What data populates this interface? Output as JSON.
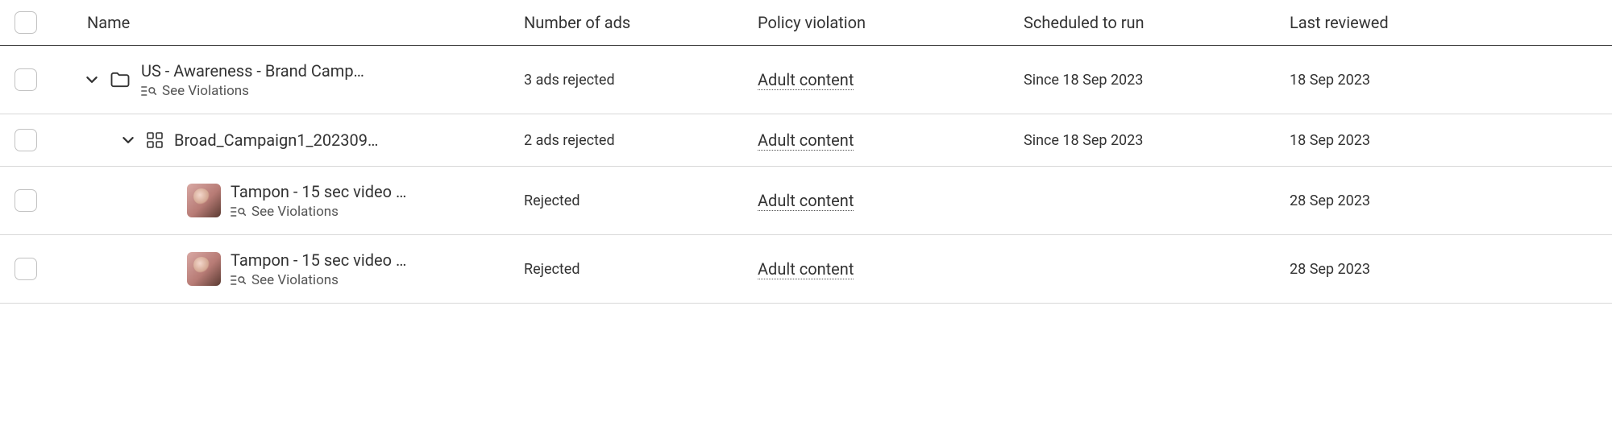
{
  "headers": {
    "name": "Name",
    "ads": "Number of ads",
    "policy": "Policy violation",
    "scheduled": "Scheduled to run",
    "reviewed": "Last reviewed"
  },
  "labels": {
    "see_violations": "See Violations"
  },
  "rows": [
    {
      "level": 1,
      "type": "campaign",
      "name": "US - Awareness - Brand Camp…",
      "has_see_violations": true,
      "ads": "3 ads rejected",
      "policy": "Adult content",
      "scheduled": "Since 18 Sep 2023",
      "reviewed": "18 Sep 2023"
    },
    {
      "level": 2,
      "type": "adset",
      "name": "Broad_Campaign1_202309…",
      "has_see_violations": false,
      "ads": "2 ads rejected",
      "policy": "Adult content",
      "scheduled": "Since 18 Sep 2023",
      "reviewed": "18 Sep 2023"
    },
    {
      "level": 3,
      "type": "ad",
      "name": "Tampon - 15 sec video …",
      "has_see_violations": true,
      "ads": "Rejected",
      "policy": "Adult content",
      "scheduled": "",
      "reviewed": "28 Sep 2023"
    },
    {
      "level": 3,
      "type": "ad",
      "name": "Tampon - 15 sec video …",
      "has_see_violations": true,
      "ads": "Rejected",
      "policy": "Adult content",
      "scheduled": "",
      "reviewed": "28 Sep 2023"
    }
  ]
}
